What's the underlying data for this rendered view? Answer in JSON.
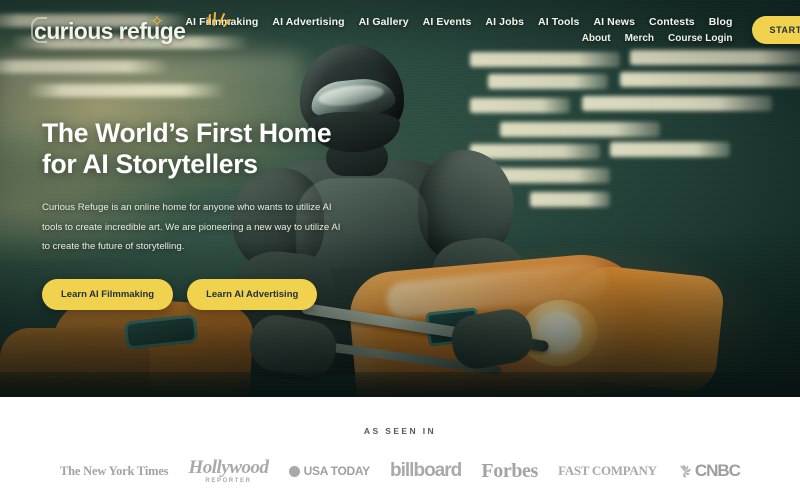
{
  "brand": {
    "name": "curious refuge",
    "star_icon": "sparkle-star-icon",
    "accent_yellow": "#F0D24F",
    "hero_bg": "#1D3A33"
  },
  "nav": {
    "primary": [
      {
        "label": "AI Filmmaking"
      },
      {
        "label": "AI Advertising"
      },
      {
        "label": "AI Gallery"
      },
      {
        "label": "AI Events"
      },
      {
        "label": "AI Jobs"
      },
      {
        "label": "AI Tools"
      },
      {
        "label": "AI News"
      },
      {
        "label": "Contests"
      },
      {
        "label": "Blog"
      }
    ],
    "secondary": [
      {
        "label": "About"
      },
      {
        "label": "Merch"
      },
      {
        "label": "Course Login"
      }
    ],
    "cta_label": "START FOR FREE"
  },
  "hero": {
    "title_line1": "The World’s First Home",
    "title_line2": "for AI Storytellers",
    "paragraph": "Curious Refuge is an online home for anyone who wants to utilize AI tools to create incredible art. We are pioneering a new way to utilize AI to create the future of storytelling.",
    "button_primary": "Learn AI Filmmaking",
    "button_secondary": "Learn AI Advertising"
  },
  "as_seen_in": {
    "label": "AS SEEN IN",
    "logos": [
      {
        "name": "the-new-york-times",
        "text": "The New York Times"
      },
      {
        "name": "the-hollywood-reporter",
        "text": "Hollywood",
        "sub": "REPORTER"
      },
      {
        "name": "usa-today",
        "text": "USA TODAY"
      },
      {
        "name": "billboard",
        "text": "billboard"
      },
      {
        "name": "forbes",
        "text": "Forbes"
      },
      {
        "name": "fast-company",
        "text": "FAST COMPANY"
      },
      {
        "name": "cnbc",
        "text": "CNBC"
      }
    ]
  }
}
